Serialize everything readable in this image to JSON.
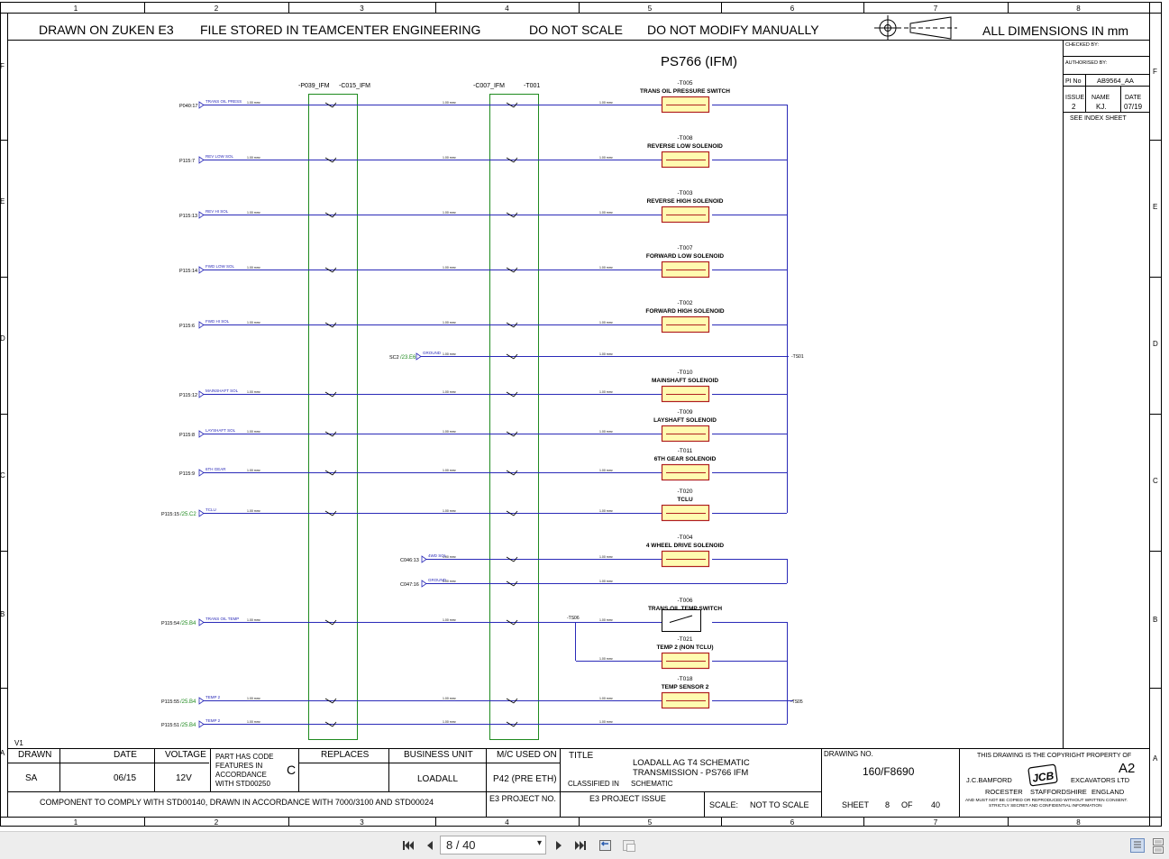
{
  "header": {
    "drawn_on": "DRAWN ON ZUKEN E3",
    "stored": "FILE STORED IN TEAMCENTER ENGINEERING",
    "no_scale": "DO NOT SCALE",
    "no_modify": "DO NOT MODIFY MANUALLY",
    "dimensions": "ALL DIMENSIONS IN mm"
  },
  "grid": {
    "cols": [
      "1",
      "2",
      "3",
      "4",
      "5",
      "6",
      "7",
      "8"
    ],
    "rows": [
      "F",
      "E",
      "D",
      "C",
      "B",
      "A"
    ]
  },
  "diagram": {
    "title": "PS766 (IFM)",
    "left_connector": [
      "-P039_IFM",
      "-C015_IFM"
    ],
    "right_connector": [
      "-C007_IFM",
      "-T001"
    ],
    "wire_labels": [
      "1.00 mm²",
      "1.00 mm²",
      "1.00 mm²"
    ],
    "version": "V1",
    "circuits": [
      {
        "source": "P040:17",
        "func": "TRANS OIL PRESS",
        "ref": "",
        "id": "-T005",
        "name": "TRANS OIL PRESSURE SWITCH",
        "type": "comp"
      },
      {
        "source": "P115:7",
        "func": "REV LOW SOL",
        "ref": "",
        "id": "-T008",
        "name": "REVERSE LOW SOLENOID",
        "type": "comp"
      },
      {
        "source": "P115:13",
        "func": "REV HI SOL",
        "ref": "",
        "id": "-T003",
        "name": "REVERSE HIGH SOLENOID",
        "type": "comp"
      },
      {
        "source": "P115:14",
        "func": "FWD LOW SOL",
        "ref": "",
        "id": "-T007",
        "name": "FORWARD LOW SOLENOID",
        "type": "comp"
      },
      {
        "source": "P115:6",
        "func": "FWD HI SOL",
        "ref": "",
        "id": "-T002",
        "name": "FORWARD HIGH SOLENOID",
        "type": "comp"
      },
      {
        "source": "SC2",
        "func": "GROUND",
        "ref": "/23.E6",
        "id": "-TS01",
        "name": "",
        "type": "ground"
      },
      {
        "source": "P115:12",
        "func": "MAINSHAFT SOL",
        "ref": "",
        "id": "-T010",
        "name": "MAINSHAFT SOLENOID",
        "type": "comp"
      },
      {
        "source": "P115:8",
        "func": "LAYSHAFT SOL",
        "ref": "",
        "id": "-T009",
        "name": "LAYSHAFT SOLENOID",
        "type": "comp"
      },
      {
        "source": "P115:9",
        "func": "6TH GEAR",
        "ref": "",
        "id": "-T011",
        "name": "6TH GEAR SOLENOID",
        "type": "comp"
      },
      {
        "source": "P115:15",
        "func": "TCLU",
        "ref": "/25.C2",
        "id": "-T020",
        "name": "TCLU",
        "type": "comp"
      },
      {
        "source": "C046:13",
        "func": "4WD SOL",
        "ref": "",
        "id": "-T004",
        "name": "4 WHEEL DRIVE SOLENOID",
        "type": "comp"
      },
      {
        "source": "C047:16",
        "func": "GROUND",
        "ref": "",
        "id": "",
        "name": "",
        "type": "return"
      },
      {
        "source": "P115:54",
        "func": "TRANS OIL TEMP",
        "ref": "/25.B4",
        "id": "-T006",
        "name": "TRANS OIL TEMP SWITCH",
        "type": "switch"
      },
      {
        "source": "",
        "func": "",
        "ref": "",
        "id": "-T021",
        "name": "TEMP 2 (NON TCLU)",
        "type": "comp"
      },
      {
        "source": "P115:55",
        "func": "TEMP 2",
        "ref": "/25.B4",
        "id": "-T018",
        "name": "TEMP SENSOR 2",
        "type": "comp"
      },
      {
        "source": "P115:51",
        "func": "TEMP 2",
        "ref": "/25.B4",
        "id": "",
        "name": "",
        "type": "return"
      }
    ],
    "splice_labels": [
      "-TS06",
      "-TS01",
      "-TS05"
    ]
  },
  "sidebox": {
    "checked_by": "CHECKED BY:",
    "authorised_by": "AUTHORISED BY:",
    "pi_no_label": "PI No",
    "pi_no": "AB9564_AA",
    "issue_label": "ISSUE",
    "name_label": "NAME",
    "date_label": "DATE",
    "issue": "2",
    "name": "KJ.",
    "date": "07/19",
    "see_index": "SEE INDEX SHEET"
  },
  "titleblock": {
    "drawn_label": "DRAWN",
    "drawn": "SA",
    "date_label": "DATE",
    "date": "06/15",
    "voltage_label": "VOLTAGE",
    "voltage": "12V",
    "part_code": "PART HAS CODE FEATURES IN ACCORDANCE WITH STD00250",
    "part_code_lines": [
      "PART HAS CODE",
      "FEATURES IN",
      "ACCORDANCE",
      "WITH STD00250"
    ],
    "code_letter": "C",
    "replaces_label": "REPLACES",
    "business_unit_label": "BUSINESS UNIT",
    "business_unit": "LOADALL",
    "mc_used_label": "M/C USED ON",
    "mc_used": "P42 (PRE ETH)",
    "title_label": "TITLE",
    "title_line1": "LOADALL AG T4 SCHEMATIC",
    "title_line2": "TRANSMISSION - PS766 IFM",
    "classified_label": "CLASSIFIED IN",
    "classified": "SCHEMATIC",
    "drawing_no_label": "DRAWING NO.",
    "drawing_no": "160/F8690",
    "comply": "COMPONENT TO COMPLY WITH STD00140, DRAWN IN ACCORDANCE WITH 7000/3100 AND STD00024",
    "e3_project_no": "E3 PROJECT NO.",
    "e3_project_issue": "E3 PROJECT ISSUE",
    "scale_label": "SCALE:",
    "scale": "NOT TO SCALE",
    "sheet_label": "SHEET",
    "sheet": "8",
    "of_label": "OF",
    "of": "40",
    "copyright": "THIS DRAWING IS THE COPYRIGHT PROPERTY OF",
    "size": "A2",
    "company_left": "J.C.BAMFORD",
    "company_right": "EXCAVATORS LTD",
    "logo": "JCB",
    "addr1": "ROCESTER",
    "addr2": "STAFFORDSHIRE",
    "addr3": "ENGLAND",
    "notice1": "AND MUST NOT BE COPIED OR REPRODUCED WITHOUT WRITTEN CONSENT.",
    "notice2": "STRICTLY SECRET AND CONFIDENTIAL INFORMATION"
  },
  "viewer": {
    "page_indicator": "8 / 40"
  }
}
